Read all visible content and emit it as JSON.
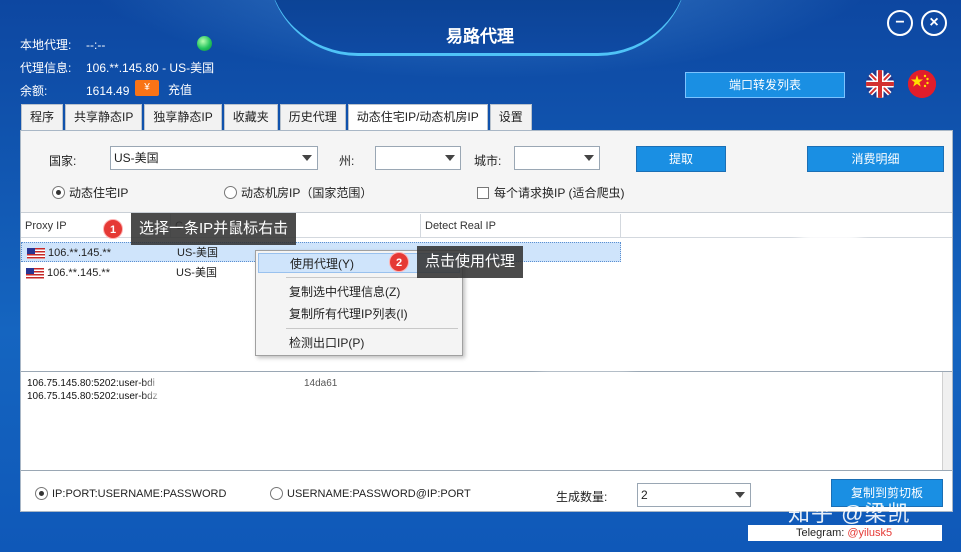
{
  "window": {
    "title": "易路代理",
    "min_icon": "−",
    "close_icon": "×"
  },
  "account": {
    "local_proxy_label": "本地代理:",
    "local_proxy_value": "--:--",
    "proxy_info_label": "代理信息:",
    "proxy_info_value": "106.**.145.80 - US-美国",
    "balance_label": "余额:",
    "balance_value": "1614.49",
    "coupon_icon": "¥",
    "recharge_label": "充值",
    "status_color": "#22c55e"
  },
  "port_forward_button": "端口转发列表",
  "languages": [
    "english-flag",
    "chinese-flag"
  ],
  "tabs": [
    {
      "label": "程序"
    },
    {
      "label": "共享静态IP"
    },
    {
      "label": "独享静态IP"
    },
    {
      "label": "收藏夹"
    },
    {
      "label": "历史代理"
    },
    {
      "label": "动态住宅IP/动态机房IP",
      "active": true
    },
    {
      "label": "设置"
    }
  ],
  "filter": {
    "country_label": "国家:",
    "country_value": "US-美国",
    "state_label": "州:",
    "state_value": "",
    "city_label": "城市:",
    "city_value": "",
    "extract_button": "提取",
    "consumption_button": "消费明细",
    "mode_dynamic_residential": "动态住宅IP",
    "mode_dynamic_datacenter": "动态机房IP（国家范围）",
    "per_request_label": "每个请求换IP (适合爬虫)"
  },
  "grid": {
    "columns": [
      "Proxy IP",
      "C",
      "Detect Real IP"
    ],
    "rows": [
      {
        "ip": "106.**.145.**",
        "country": "US-美国"
      },
      {
        "ip": "106.**.145.**",
        "country": "US-美国"
      }
    ]
  },
  "context_menu": {
    "items": [
      "使用代理(Y)",
      "复制选中代理信息(Z)",
      "复制所有代理IP列表(I)",
      "检测出口IP(P)"
    ]
  },
  "callouts": {
    "step1_number": "1",
    "step1_text": "选择一条IP并鼠标右击",
    "step2_number": "2",
    "step2_text": "点击使用代理"
  },
  "output": {
    "lines": [
      "106.75.145.80:5202:user-bdi",
      "106.75.145.80:5202:user-bdz"
    ],
    "fragment": "14da61"
  },
  "bottom": {
    "format_a": "IP:PORT:USERNAME:PASSWORD",
    "format_b": "USERNAME:PASSWORD@IP:PORT",
    "count_label": "生成数量:",
    "count_value": "2",
    "copy_button": "复制到剪切板"
  },
  "watermark": {
    "zhihu": "知乎 @梁凯",
    "telegram_label": "Telegram:",
    "telegram_handle": "@yilusk5"
  }
}
